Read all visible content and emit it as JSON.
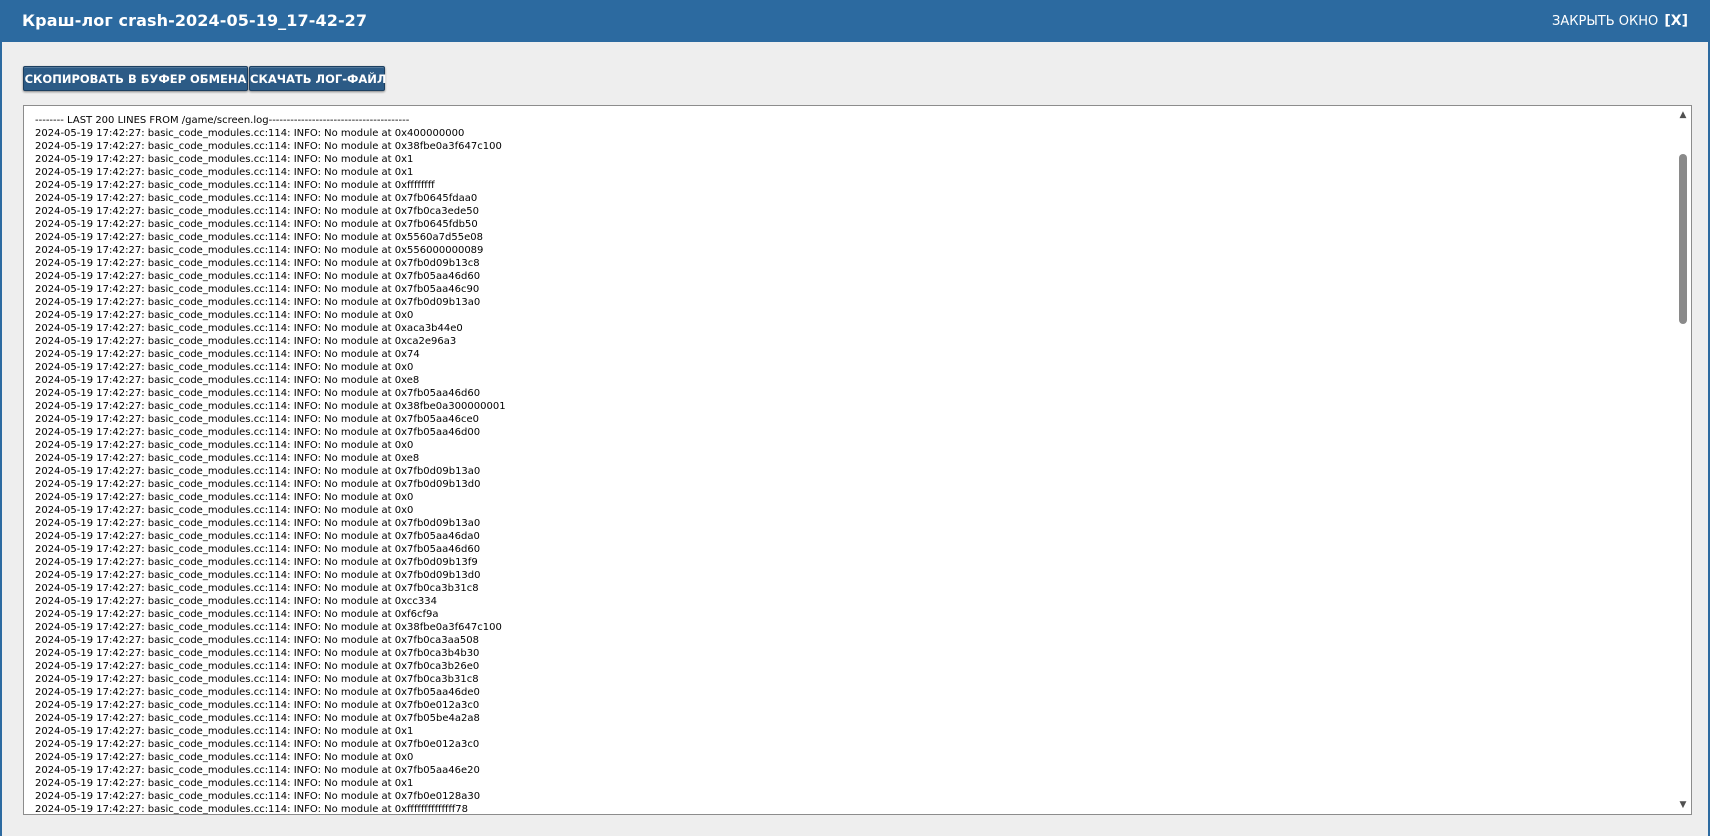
{
  "window": {
    "title": "Краш-лог crash-2024-05-19_17-42-27",
    "close_label": "ЗАКРЫТЬ ОКНО",
    "close_x": "[X]"
  },
  "toolbar": {
    "copy_label": "СКОПИРОВАТЬ В БУФЕР ОБМЕНА",
    "download_label": "СКАЧАТЬ ЛОГ-ФАЙЛ"
  },
  "scrollbar": {
    "up_glyph": "▲",
    "down_glyph": "▼"
  },
  "log": {
    "lines": [
      "-------- LAST 200 LINES FROM /game/screen.log---------------------------------------",
      "2024-05-19 17:42:27: basic_code_modules.cc:114: INFO: No module at 0x400000000",
      "2024-05-19 17:42:27: basic_code_modules.cc:114: INFO: No module at 0x38fbe0a3f647c100",
      "2024-05-19 17:42:27: basic_code_modules.cc:114: INFO: No module at 0x1",
      "2024-05-19 17:42:27: basic_code_modules.cc:114: INFO: No module at 0x1",
      "2024-05-19 17:42:27: basic_code_modules.cc:114: INFO: No module at 0xffffffff",
      "2024-05-19 17:42:27: basic_code_modules.cc:114: INFO: No module at 0x7fb0645fdaa0",
      "2024-05-19 17:42:27: basic_code_modules.cc:114: INFO: No module at 0x7fb0ca3ede50",
      "2024-05-19 17:42:27: basic_code_modules.cc:114: INFO: No module at 0x7fb0645fdb50",
      "2024-05-19 17:42:27: basic_code_modules.cc:114: INFO: No module at 0x5560a7d55e08",
      "2024-05-19 17:42:27: basic_code_modules.cc:114: INFO: No module at 0x556000000089",
      "2024-05-19 17:42:27: basic_code_modules.cc:114: INFO: No module at 0x7fb0d09b13c8",
      "2024-05-19 17:42:27: basic_code_modules.cc:114: INFO: No module at 0x7fb05aa46d60",
      "2024-05-19 17:42:27: basic_code_modules.cc:114: INFO: No module at 0x7fb05aa46c90",
      "2024-05-19 17:42:27: basic_code_modules.cc:114: INFO: No module at 0x7fb0d09b13a0",
      "2024-05-19 17:42:27: basic_code_modules.cc:114: INFO: No module at 0x0",
      "2024-05-19 17:42:27: basic_code_modules.cc:114: INFO: No module at 0xaca3b44e0",
      "2024-05-19 17:42:27: basic_code_modules.cc:114: INFO: No module at 0xca2e96a3",
      "2024-05-19 17:42:27: basic_code_modules.cc:114: INFO: No module at 0x74",
      "2024-05-19 17:42:27: basic_code_modules.cc:114: INFO: No module at 0x0",
      "2024-05-19 17:42:27: basic_code_modules.cc:114: INFO: No module at 0xe8",
      "2024-05-19 17:42:27: basic_code_modules.cc:114: INFO: No module at 0x7fb05aa46d60",
      "2024-05-19 17:42:27: basic_code_modules.cc:114: INFO: No module at 0x38fbe0a300000001",
      "2024-05-19 17:42:27: basic_code_modules.cc:114: INFO: No module at 0x7fb05aa46ce0",
      "2024-05-19 17:42:27: basic_code_modules.cc:114: INFO: No module at 0x7fb05aa46d00",
      "2024-05-19 17:42:27: basic_code_modules.cc:114: INFO: No module at 0x0",
      "2024-05-19 17:42:27: basic_code_modules.cc:114: INFO: No module at 0xe8",
      "2024-05-19 17:42:27: basic_code_modules.cc:114: INFO: No module at 0x7fb0d09b13a0",
      "2024-05-19 17:42:27: basic_code_modules.cc:114: INFO: No module at 0x7fb0d09b13d0",
      "2024-05-19 17:42:27: basic_code_modules.cc:114: INFO: No module at 0x0",
      "2024-05-19 17:42:27: basic_code_modules.cc:114: INFO: No module at 0x0",
      "2024-05-19 17:42:27: basic_code_modules.cc:114: INFO: No module at 0x7fb0d09b13a0",
      "2024-05-19 17:42:27: basic_code_modules.cc:114: INFO: No module at 0x7fb05aa46da0",
      "2024-05-19 17:42:27: basic_code_modules.cc:114: INFO: No module at 0x7fb05aa46d60",
      "2024-05-19 17:42:27: basic_code_modules.cc:114: INFO: No module at 0x7fb0d09b13f9",
      "2024-05-19 17:42:27: basic_code_modules.cc:114: INFO: No module at 0x7fb0d09b13d0",
      "2024-05-19 17:42:27: basic_code_modules.cc:114: INFO: No module at 0x7fb0ca3b31c8",
      "2024-05-19 17:42:27: basic_code_modules.cc:114: INFO: No module at 0xcc334",
      "2024-05-19 17:42:27: basic_code_modules.cc:114: INFO: No module at 0xf6cf9a",
      "2024-05-19 17:42:27: basic_code_modules.cc:114: INFO: No module at 0x38fbe0a3f647c100",
      "2024-05-19 17:42:27: basic_code_modules.cc:114: INFO: No module at 0x7fb0ca3aa508",
      "2024-05-19 17:42:27: basic_code_modules.cc:114: INFO: No module at 0x7fb0ca3b4b30",
      "2024-05-19 17:42:27: basic_code_modules.cc:114: INFO: No module at 0x7fb0ca3b26e0",
      "2024-05-19 17:42:27: basic_code_modules.cc:114: INFO: No module at 0x7fb0ca3b31c8",
      "2024-05-19 17:42:27: basic_code_modules.cc:114: INFO: No module at 0x7fb05aa46de0",
      "2024-05-19 17:42:27: basic_code_modules.cc:114: INFO: No module at 0x7fb0e012a3c0",
      "2024-05-19 17:42:27: basic_code_modules.cc:114: INFO: No module at 0x7fb05be4a2a8",
      "2024-05-19 17:42:27: basic_code_modules.cc:114: INFO: No module at 0x1",
      "2024-05-19 17:42:27: basic_code_modules.cc:114: INFO: No module at 0x7fb0e012a3c0",
      "2024-05-19 17:42:27: basic_code_modules.cc:114: INFO: No module at 0x0",
      "2024-05-19 17:42:27: basic_code_modules.cc:114: INFO: No module at 0x7fb05aa46e20",
      "2024-05-19 17:42:27: basic_code_modules.cc:114: INFO: No module at 0x1",
      "2024-05-19 17:42:27: basic_code_modules.cc:114: INFO: No module at 0x7fb0e0128a30",
      "2024-05-19 17:42:27: basic_code_modules.cc:114: INFO: No module at 0xffffffffffffff78"
    ]
  }
}
